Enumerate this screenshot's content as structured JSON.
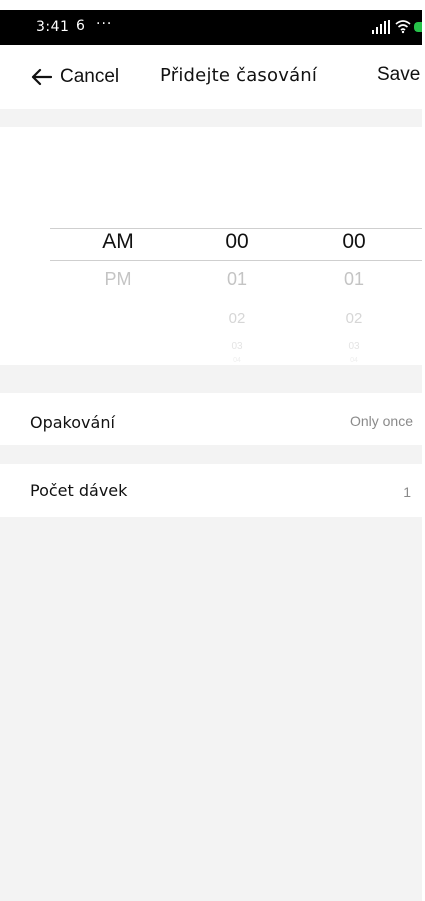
{
  "status_bar": {
    "time": "3:41",
    "left_icon": "6",
    "dots": "···"
  },
  "header": {
    "cancel_label": "Cancel",
    "title": "Přidejte časování",
    "save_label": "Save"
  },
  "picker": {
    "period": [
      "AM",
      "PM"
    ],
    "hours": [
      "00",
      "01",
      "02",
      "03",
      "04"
    ],
    "minutes": [
      "00",
      "01",
      "02",
      "03",
      "04"
    ]
  },
  "rows": [
    {
      "label": "Opakování",
      "value": "Only once"
    },
    {
      "label": "Počet dávek",
      "value": "1"
    }
  ],
  "colors": {
    "status_bar_bg": "#000000",
    "battery": "#27c24a",
    "background": "#f3f3f3"
  },
  "icons": {
    "back": "back-arrow-icon",
    "signal": "signal-icon",
    "wifi": "wifi-icon",
    "battery": "battery-icon"
  }
}
